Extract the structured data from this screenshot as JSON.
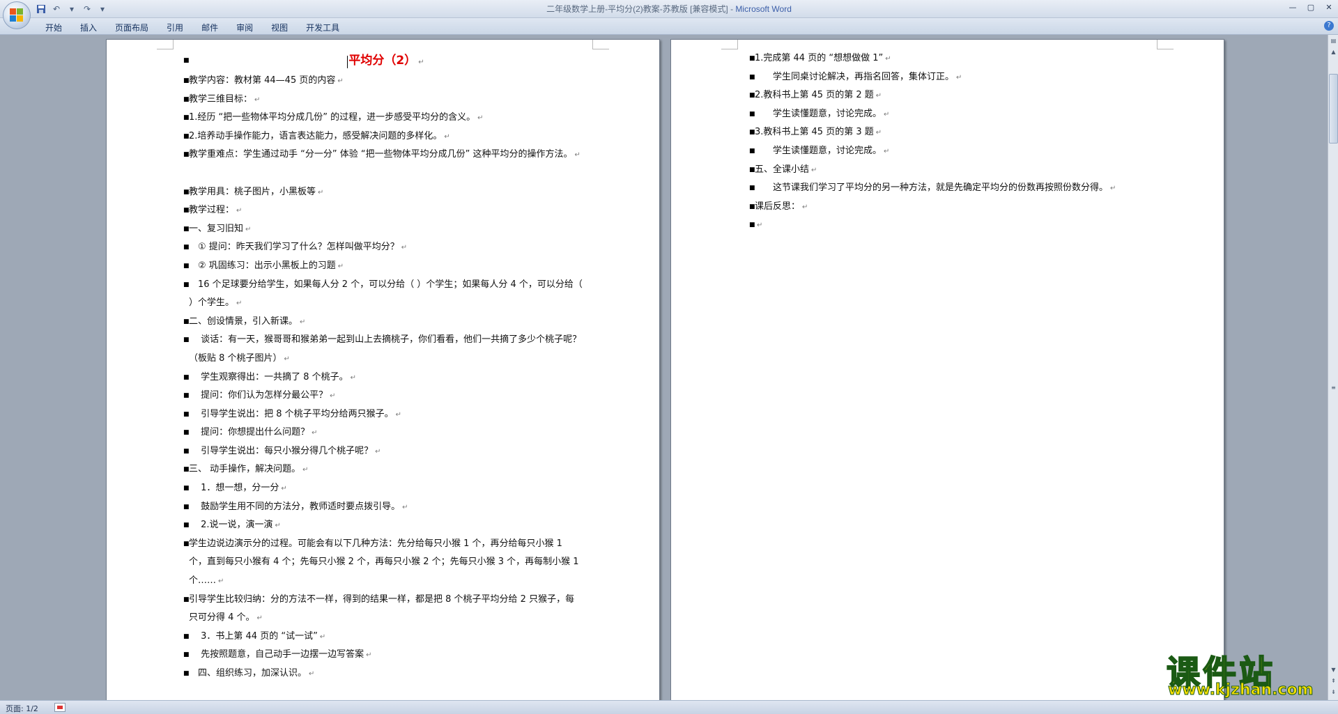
{
  "window": {
    "title_doc": "二年级数学上册-平均分(2)教案-苏教版 [兼容模式] - ",
    "title_app": "Microsoft Word"
  },
  "ribbon": {
    "tabs": [
      "开始",
      "插入",
      "页面布局",
      "引用",
      "邮件",
      "审阅",
      "视图",
      "开发工具"
    ]
  },
  "status": {
    "page": "页面: 1/2"
  },
  "page1": {
    "title": "平均分（2）",
    "lines": [
      "教学内容：教材第 44—45 页的内容",
      "教学三维目标：",
      "1.经历 “把一些物体平均分成几份” 的过程，进一步感受平均分的含义。",
      "2.培养动手操作能力，语言表达能力，感受解决问题的多样化。",
      "教学重难点：学生通过动手 “分一分” 体验 “把一些物体平均分成几份” 这种平均分的操作方法。",
      "教学用具：桃子图片，小黑板等",
      "教学过程：",
      "一、复习旧知",
      "　① 提问：昨天我们学习了什么？怎样叫做平均分？",
      "　② 巩固练习：出示小黑板上的习题",
      "　16 个足球要分给学生，如果每人分 2 个，可以分给（ ）个学生；如果每人分 4 个，可以分给（ ）个学生。",
      "二、创设情景，引入新课。",
      "　 谈话：有一天，猴哥哥和猴弟弟一起到山上去摘桃子，你们看看，他们一共摘了多少个桃子呢？（板贴 8 个桃子图片）",
      "　 学生观察得出：一共摘了 8 个桃子。",
      "　 提问：你们认为怎样分最公平？",
      "　 引导学生说出：把 8 个桃子平均分给两只猴子。",
      "　 提问：你想提出什么问题？",
      "　 引导学生说出：每只小猴分得几个桃子呢？",
      "三、 动手操作，解决问题。",
      "　 1．想一想，分一分",
      "　 鼓励学生用不同的方法分，教师适时要点拨引导。",
      "　 2.说一说，演一演",
      "学生边说边演示分的过程。可能会有以下几种方法：先分给每只小猴 1 个，再分给每只小猴 1 个，直到每只小猴有 4 个；先每只小猴 2 个，再每只小猴 2 个；先每只小猴 3 个，再每制小猴 1 个……",
      "引导学生比较归纳：分的方法不一样，得到的结果一样，都是把 8 个桃子平均分给 2 只猴子，每只可分得 4 个。",
      "　 3．书上第 44 页的 “试一试”",
      "　 先按照题意，自己动手一边摆一边写答案",
      "　四、组织练习，加深认识。"
    ]
  },
  "page2": {
    "lines": [
      "1.完成第 44 页的 “想想做做 1”",
      "　　学生同桌讨论解决，再指名回答，集体订正。",
      "2.教科书上第 45 页的第 2 题",
      "　　学生读懂题意，讨论完成。",
      "3.教科书上第 45 页的第 3 题",
      "　　学生读懂题意，讨论完成。",
      "五、全课小结",
      "　　这节课我们学习了平均分的另一种方法，就是先确定平均分的份数再按照份数分得。",
      "课后反思：",
      ""
    ]
  },
  "watermark": {
    "main": "课件站",
    "url": "www.kjzhan.com"
  }
}
